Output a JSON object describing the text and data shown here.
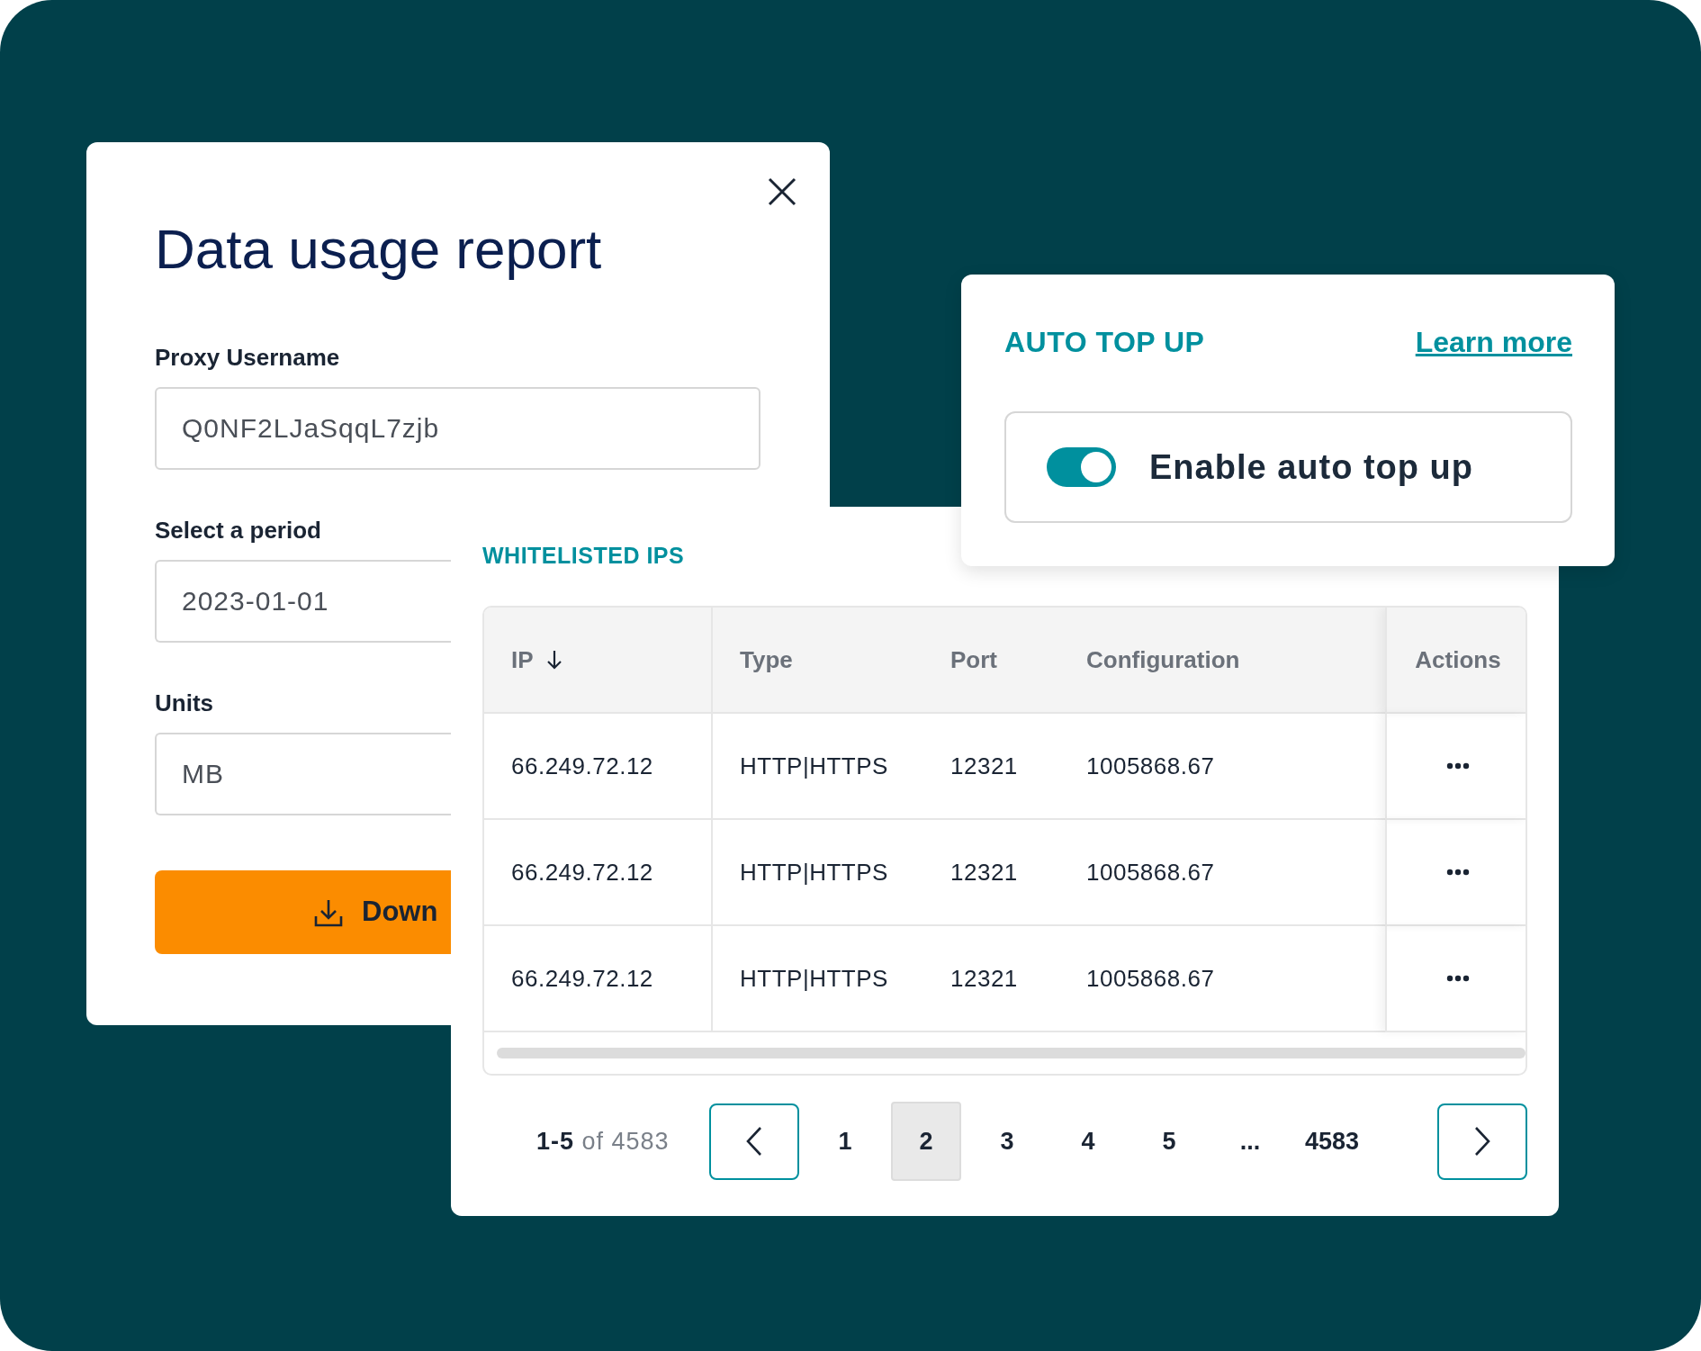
{
  "report_dialog": {
    "title": "Data usage report",
    "fields": [
      {
        "label": "Proxy Username",
        "value": "Q0NF2LJaSqqL7zjb"
      },
      {
        "label": "Select a period",
        "value": "2023-01-01"
      },
      {
        "label": "Units",
        "value": "MB"
      }
    ],
    "download_button": "Down"
  },
  "whitelisted_ips": {
    "title": "WHITELISTED IPS",
    "columns": [
      {
        "label": "IP",
        "sorted": true
      },
      {
        "label": "Type",
        "sorted": false
      },
      {
        "label": "Port",
        "sorted": false
      },
      {
        "label": "Configuration",
        "sorted": false
      },
      {
        "label": "Actions",
        "sorted": false
      }
    ],
    "rows": [
      [
        "66.249.72.12",
        "HTTP|HTTPS",
        "12321",
        "1005868.67"
      ],
      [
        "66.249.72.12",
        "HTTP|HTTPS",
        "12321",
        "1005868.67"
      ],
      [
        "66.249.72.12",
        "HTTP|HTTPS",
        "12321",
        "1005868.67"
      ]
    ],
    "pagination": {
      "range": "**1-5** of 4583",
      "pages": [
        {
          "label": "1",
          "selected": false
        },
        {
          "label": "2",
          "selected": true
        },
        {
          "label": "3",
          "selected": false
        },
        {
          "label": "4",
          "selected": false
        },
        {
          "label": "5",
          "selected": false
        },
        {
          "label": "...",
          "selected": false
        },
        {
          "label": "4583",
          "selected": false
        }
      ]
    }
  },
  "auto_top_up": {
    "title": "AUTO TOP UP",
    "link": "Learn more",
    "toggle": {
      "label": "Enable auto top up",
      "on": true
    }
  }
}
